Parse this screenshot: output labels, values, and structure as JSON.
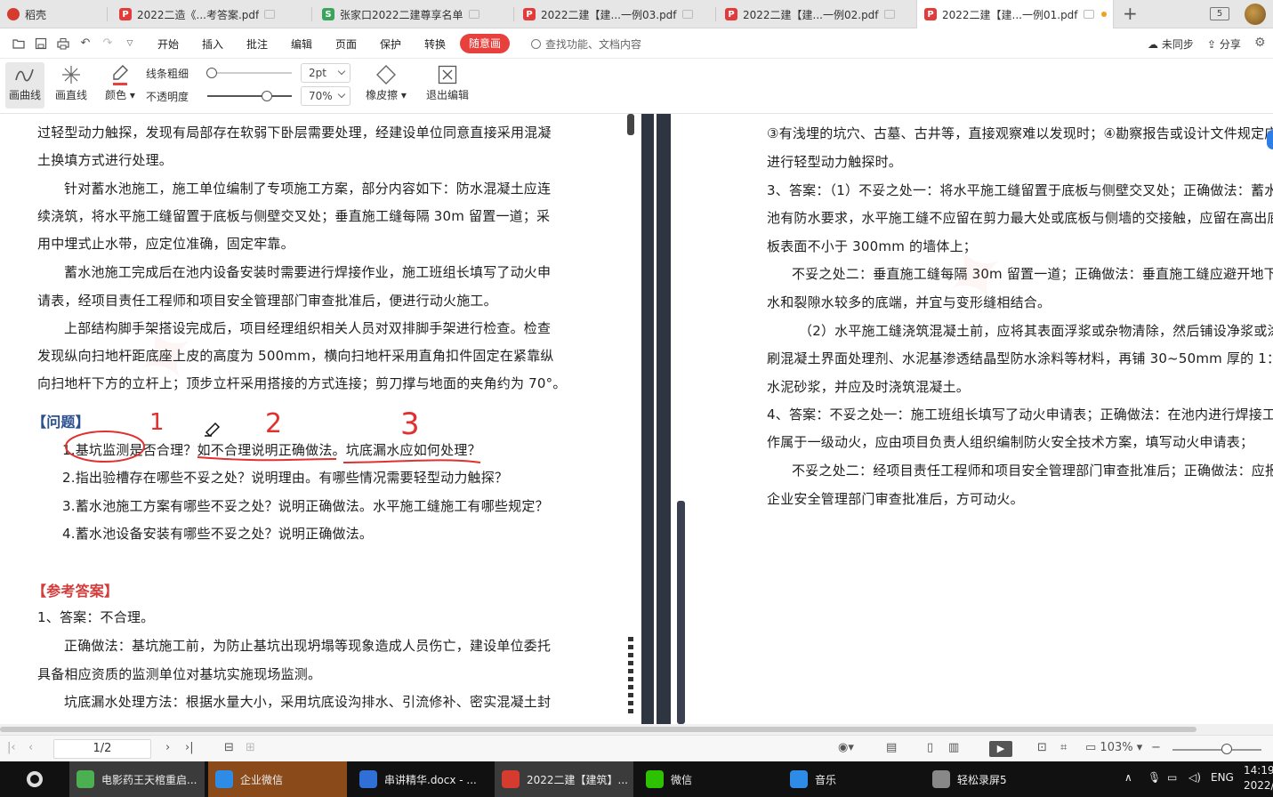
{
  "tabs": [
    {
      "label": "稻壳",
      "type": "logo"
    },
    {
      "label": "2022二造《...考答案.pdf",
      "type": "pdf"
    },
    {
      "label": "张家口2022二建尊享名单",
      "type": "green"
    },
    {
      "label": "2022二建【建...一例03.pdf",
      "type": "pdf"
    },
    {
      "label": "2022二建【建...一例02.pdf",
      "type": "pdf"
    },
    {
      "label": "2022二建【建...一例01.pdf",
      "type": "pdf"
    }
  ],
  "tab_count": "5",
  "menu": {
    "items": [
      "开始",
      "插入",
      "批注",
      "编辑",
      "页面",
      "保护",
      "转换"
    ],
    "pen_mode": "随意画",
    "search_placeholder": "查找功能、文档内容",
    "sync": "未同步",
    "share": "分享"
  },
  "toolbar": {
    "draw_curve": "画曲线",
    "draw_line": "画直线",
    "color": "颜色",
    "line_width_label": "线条粗细",
    "opacity_label": "不透明度",
    "line_width_value": "2pt",
    "opacity_value": "70%",
    "line_width_level": 0.05,
    "opacity_level": 0.7,
    "eraser": "橡皮擦",
    "exit_edit": "退出编辑",
    "accent_color": "#e8403c"
  },
  "doc_left": {
    "p1": [
      "过轻型动力触探，发现有局部存在软弱下卧层需要处理，经建设单位同意直接采用混凝",
      "土换填方式进行处理。"
    ],
    "p2": [
      "针对蓄水池施工，施工单位编制了专项施工方案，部分内容如下：防水混凝土应连",
      "续浇筑，将水平施工缝留置于底板与侧壁交叉处；垂直施工缝每隔 30m 留置一道；采",
      "用中埋式止水带，应定位准确，固定牢靠。"
    ],
    "p3": [
      "蓄水池施工完成后在池内设备安装时需要进行焊接作业，施工班组长填写了动火申",
      "请表，经项目责任工程师和项目安全管理部门审查批准后，便进行动火施工。"
    ],
    "p4": [
      "上部结构脚手架搭设完成后，项目经理组织相关人员对双排脚手架进行检查。检查",
      "发现纵向扫地杆距底座上皮的高度为 500mm，横向扫地杆采用直角扣件固定在紧靠纵",
      "向扫地杆下方的立杆上；顶步立杆采用搭接的方式连接；剪刀撑与地面的夹角约为 70°。"
    ],
    "questions_title": "【问题】",
    "questions": [
      "1.基坑监测是否合理？如不合理说明正确做法。坑底漏水应如何处理？",
      "2.指出验槽存在哪些不妥之处？说明理由。有哪些情况需要轻型动力触探？",
      "3.蓄水池施工方案有哪些不妥之处？说明正确做法。水平施工缝施工有哪些规定？",
      "4.蓄水池设备安装有哪些不妥之处？说明正确做法。"
    ],
    "answers_title": "【参考答案】",
    "answers": [
      "1、答案：不合理。",
      "正确做法：基坑施工前，为防止基坑出现坍塌等现象造成人员伤亡，建设单位委托",
      "具备相应资质的监测单位对基坑实施现场监测。",
      "坑底漏水处理方法：根据水量大小，采用坑底设沟排水、引流修补、密实混凝土封"
    ]
  },
  "doc_right": {
    "lines": [
      "③有浅埋的坑穴、古墓、古井等，直接观察难以发现时；④勘察报告或设计文件规定应",
      "进行轻型动力触探时。",
      "3、答案：（1）不妥之处一：将水平施工缝留置于底板与侧壁交叉处；正确做法：蓄水",
      "池有防水要求，水平施工缝不应留在剪力最大处或底板与侧墙的交接触，应留在高出底",
      "板表面不小于 300mm 的墙体上；",
      "不妥之处二：垂直施工缝每隔 30m 留置一道；正确做法：垂直施工缝应避开地下",
      "水和裂隙水较多的底端，并宜与变形缝相结合。",
      "（2）水平施工缝浇筑混凝土前，应将其表面浮浆或杂物清除，然后铺设净浆或涂",
      "刷混凝土界面处理剂、水泥基渗透结晶型防水涂料等材料，再铺 30~50mm 厚的 1：1",
      "水泥砂浆，并应及时浇筑混凝土。",
      "4、答案：不妥之处一：施工班组长填写了动火申请表；正确做法：在池内进行焊接工",
      "作属于一级动火，应由项目负责人组织编制防火安全技术方案，填写动火申请表；",
      "不妥之处二：经项目责任工程师和项目安全管理部门审查批准后；正确做法：应报",
      "企业安全管理部门审查批准后，方可动火。"
    ]
  },
  "annotations": {
    "marks": [
      "1",
      "2",
      "3"
    ],
    "color": "#e03030"
  },
  "status": {
    "page": "1/2",
    "zoom": "103%",
    "zoom_level": 0.61
  },
  "taskbar": {
    "items": [
      {
        "label": "电影药王天棺重启...",
        "color": "#4caf50"
      },
      {
        "label": "企业微信",
        "color": "#2f8ce6"
      },
      {
        "label": "串讲精华.docx - ...",
        "color": "#2f6fd6"
      },
      {
        "label": "2022二建【建筑】...",
        "color": "#d63b2f"
      },
      {
        "label": "微信",
        "color": "#2dc100"
      },
      {
        "label": "音乐",
        "color": "#2f8ce6"
      },
      {
        "label": "轻松录屏5",
        "color": "#888888"
      }
    ],
    "lang": "ENG",
    "time": "14:19",
    "date": "2022/"
  }
}
